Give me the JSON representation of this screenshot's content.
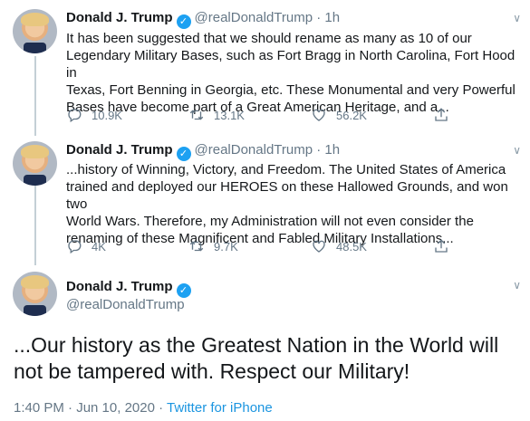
{
  "tweets": [
    {
      "author": "Donald J. Trump",
      "handle": "@realDonaldTrump",
      "separator": "·",
      "time": "1h",
      "text_lines": [
        "It has been suggested that we should rename as many as 10 of our",
        "Legendary Military Bases, such as Fort Bragg in North Carolina, Fort Hood in",
        "Texas, Fort Benning in Georgia, etc. These Monumental and very Powerful",
        "Bases have become part of a Great American Heritage, and a..."
      ],
      "replies": "10.9K",
      "retweets": "13.1K",
      "likes": "56.2K"
    },
    {
      "author": "Donald J. Trump",
      "handle": "@realDonaldTrump",
      "separator": "·",
      "time": "1h",
      "text_lines": [
        "...history of Winning, Victory, and Freedom. The United States of America",
        "trained and deployed our HEROES on these Hallowed Grounds, and won two",
        "World Wars. Therefore, my Administration will not even consider the",
        "renaming of these Magnificent and Fabled Military Installations..."
      ],
      "replies": "4K",
      "retweets": "9.7K",
      "likes": "48.5K"
    }
  ],
  "main_tweet": {
    "author": "Donald J. Trump",
    "handle": "@realDonaldTrump",
    "text_lines": [
      "...Our history as the Greatest Nation in the World will",
      "not be tampered with. Respect our Military!"
    ],
    "timestamp": "1:40 PM · Jun 10, 2020 ·",
    "source": "Twitter for iPhone"
  },
  "icons": {
    "verified": "verified-badge-icon",
    "reply": "reply-icon",
    "retweet": "retweet-icon",
    "like": "heart-icon",
    "share": "share-icon",
    "more": "chevron-down-icon"
  },
  "colors": {
    "accent": "#1da1f2",
    "link": "#1b95e0",
    "secondary_text": "#657786",
    "primary_text": "#14171a"
  }
}
